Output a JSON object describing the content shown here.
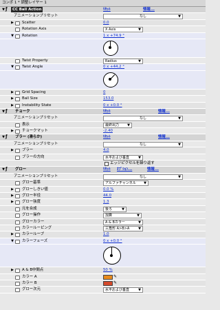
{
  "title": "コンポ 1 * 調整レイヤー 1",
  "sections": {
    "cc_ball": {
      "name": "CC Ball Action",
      "reset": "ﾘｾｯﾄ",
      "info": "情報..."
    },
    "chalk": {
      "name": "チョーク",
      "reset": "ﾘｾｯﾄ",
      "info": "情報..."
    },
    "blur": {
      "name": "ブラー (滑らか)",
      "reset": "ﾘｾｯﾄ",
      "info": "情報..."
    },
    "glow": {
      "name": "グロー",
      "reset": "ﾘｾｯﾄ",
      "options": "ｵﾌﾟｼｮﾝ...",
      "info": "情報..."
    }
  },
  "labels": {
    "animation_preset": "アニメーションプリセット",
    "scatter": "Scatter",
    "rotation_axis": "Rotation Axis",
    "rotation": "Rotation",
    "twist_property": "Twist Property",
    "twist_angle": "Twist Angle",
    "grid_spacing": "Grid Spacing",
    "ball_size": "Ball Size",
    "instability_state": "Instability State",
    "display": "表示",
    "chalk_matte": "チョークマット",
    "blur": "ブラー",
    "blur_dir": "ブラーの方向",
    "glow_base": "グロー基準",
    "glow_threshold": "グローしきい値",
    "glow_radius": "グロー半径",
    "glow_intensity": "グロー強度",
    "composite_original": "元を合成",
    "glow_op": "グロー操作",
    "glow_colors": "グローカラー",
    "color_looping": "カラールーピング",
    "color_loops": "カラーループ",
    "color_phase": "カラーフェーズ",
    "ab_midpoint": "A & B中間点",
    "color_a": "カラー A",
    "color_b": "カラー B",
    "glow_dims": "グロー次元"
  },
  "values": {
    "preset_none": "なし",
    "scatter": "0.0",
    "rotation_axis": "X Axis",
    "rotation": "1 x +74.9 °",
    "twist_property": "Radius",
    "twist_angle": "0 x +44.2 °",
    "grid_spacing": "0",
    "ball_size": "153.0",
    "instability_state": "0 x +0.0 °",
    "display": "最終出力",
    "chalk_matte": "-2.40",
    "blur": "4.0",
    "blur_dir": "水平および垂直",
    "edge_repeat": "エッジピクセルを繰り返す",
    "glow_base": "アルファチャンネル",
    "glow_threshold": "0.0 %",
    "glow_radius": "44.0",
    "glow_intensity": "1.3",
    "composite_original": "後ろ",
    "glow_op": "加算",
    "glow_colors": "A & Bカラー",
    "color_looping": "三角形 A>B>A",
    "color_loops": "1.0",
    "color_phase": "0 x +0.0 °",
    "ab_midpoint": "50 %",
    "glow_dims": "水平および垂直"
  },
  "colors": {
    "color_a": "#e88a1c",
    "color_b": "#d44a2c"
  }
}
